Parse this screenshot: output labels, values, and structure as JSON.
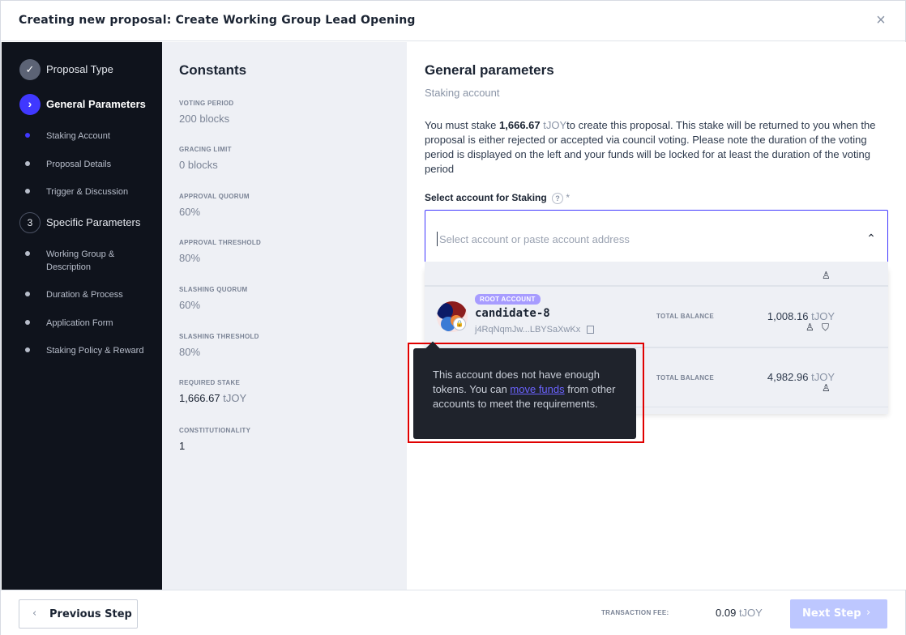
{
  "header": {
    "title": "Creating new proposal: Create Working Group Lead Opening",
    "close_icon": "×"
  },
  "sidebar": {
    "steps": [
      {
        "label": "Proposal Type",
        "state": "done",
        "icon": "✓"
      },
      {
        "label": "General Parameters",
        "state": "active",
        "icon": "›"
      },
      {
        "label": "Specific Parameters",
        "state": "pending",
        "icon": "3"
      }
    ],
    "substeps_general": [
      "Staking Account",
      "Proposal Details",
      "Trigger & Discussion"
    ],
    "substeps_specific": [
      "Working Group &",
      "Description",
      "Duration & Process",
      "Application Form",
      "Staking Policy & Reward"
    ]
  },
  "constants": {
    "title": "Constants",
    "items": [
      {
        "key": "VOTING PERIOD",
        "value": "200",
        "unit": "blocks"
      },
      {
        "key": "GRACING LIMIT",
        "value": "0",
        "unit": "blocks"
      },
      {
        "key": "APPROVAL QUORUM",
        "value": "60",
        "unit": "%"
      },
      {
        "key": "APPROVAL THRESHOLD",
        "value": "80",
        "unit": "%"
      },
      {
        "key": "SLASHING QUORUM",
        "value": "60",
        "unit": "%"
      },
      {
        "key": "SLASHING THRESHOLD",
        "value": "80",
        "unit": "%"
      },
      {
        "key": "REQUIRED STAKE",
        "value": "1,666.67",
        "unit": "tJOY"
      },
      {
        "key": "CONSTITUTIONALITY",
        "value": "1",
        "unit": ""
      }
    ]
  },
  "main": {
    "title": "General parameters",
    "subtitle": "Staking account",
    "para_pre": "You must stake ",
    "para_amount": "1,666.67",
    "para_unit": " tJOY",
    "para_post": "to create this proposal. This stake will be returned to you when the proposal is either rejected or accepted via council voting. Please note the duration of the voting period is displayed on the left and your funds will be locked for at least the duration of the voting period",
    "select_label": "Select account for Staking",
    "select_help": "?",
    "select_required": "*",
    "select_placeholder": "Select account or paste account address",
    "chevron_icon": "⌃"
  },
  "accounts": [
    {
      "badge": "ROOT ACCOUNT",
      "name": "candidate-8",
      "address": "j4RqNqmJw...LBYSaXwKx",
      "balance_label": "TOTAL BALANCE",
      "balance": "1,008.16",
      "unit": "tJOY"
    },
    {
      "balance_label": "TOTAL BALANCE",
      "balance": "4,982.96",
      "unit": "tJOY"
    }
  ],
  "tooltip": {
    "pre": "This account does not have enough tokens. You can ",
    "link": "move funds",
    "post": " from other accounts to meet the requirements."
  },
  "footer": {
    "prev_label": "Previous Step",
    "prev_icon": "‹",
    "fee_label": "TRANSACTION FEE:",
    "fee_value": "0.09",
    "fee_unit": "tJOY",
    "next_label": "Next Step",
    "next_icon": "›"
  },
  "colors": {
    "accent": "#4038ff",
    "sidebar_bg": "#0f131c",
    "highlight": "#e00000"
  }
}
